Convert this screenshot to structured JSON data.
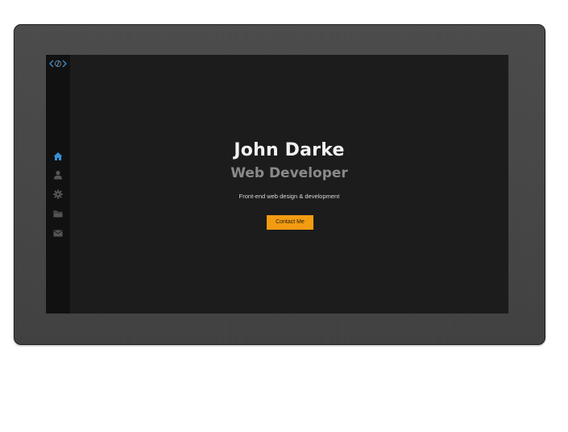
{
  "hero": {
    "name": "John Darke",
    "role": "Web Developer",
    "tagline": "Front-end web design & development",
    "contact_label": "Contact Me"
  },
  "sidebar": {
    "logo": "code-logo-icon",
    "items": [
      {
        "icon": "home-icon",
        "active": true
      },
      {
        "icon": "user-icon",
        "active": false
      },
      {
        "icon": "gear-icon",
        "active": false
      },
      {
        "icon": "folder-icon",
        "active": false
      },
      {
        "icon": "envelope-icon",
        "active": false
      }
    ]
  },
  "colors": {
    "accent": "#f39c12",
    "active_icon": "#3a8fd6",
    "inactive_icon": "#555555",
    "screen_bg": "#1c1c1c",
    "sidebar_bg": "#111111",
    "name_text": "#f2f2f2",
    "role_text": "#8a8a8a"
  }
}
